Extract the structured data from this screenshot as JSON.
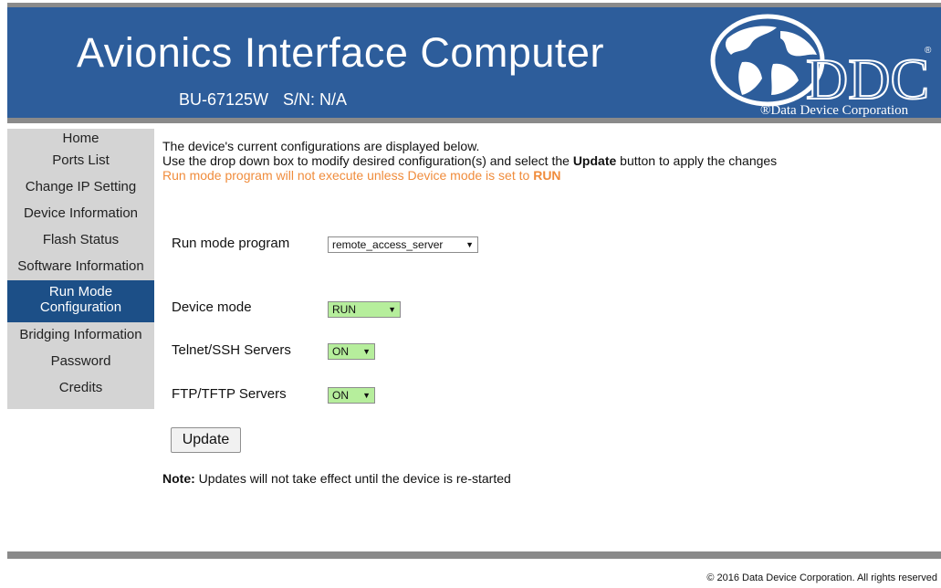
{
  "header": {
    "title": "Avionics Interface Computer",
    "model": "BU-67125W",
    "serial": "S/N: N/A",
    "logo_text": "DDC",
    "logo_caption": "®Data Device Corporation",
    "logo_mark": "®"
  },
  "sidebar": {
    "items": [
      {
        "label": "Home"
      },
      {
        "label": "Ports List"
      },
      {
        "label": "Change IP Setting"
      },
      {
        "label": "Device Information"
      },
      {
        "label": "Flash Status"
      },
      {
        "label": "Software Information"
      },
      {
        "label": "Run Mode Configuration"
      },
      {
        "label": "Bridging Information"
      },
      {
        "label": "Password"
      },
      {
        "label": "Credits"
      }
    ],
    "active_index": 6
  },
  "main": {
    "intro_line1": "The device's current configurations are displayed below.",
    "intro_line2_prefix": "Use the drop down box to modify desired configuration(s) and select the ",
    "intro_line2_bold": "Update",
    "intro_line2_suffix": " button to apply the changes",
    "warning_prefix": "Run mode program will not execute unless Device mode is set to ",
    "warning_bold": "RUN",
    "fields": {
      "run_mode_program": {
        "label": "Run mode program",
        "value": "remote_access_server"
      },
      "device_mode": {
        "label": "Device mode",
        "value": "RUN"
      },
      "telnet_ssh": {
        "label": "Telnet/SSH Servers",
        "value": "ON"
      },
      "ftp_tftp": {
        "label": "FTP/TFTP Servers",
        "value": "ON"
      }
    },
    "update_label": "Update",
    "note_bold": "Note:",
    "note_text": " Updates will not take effect until the device is re-started"
  },
  "footer": {
    "copyright": "© 2016 Data Device Corporation. All rights reserved"
  },
  "colors": {
    "header_bg": "#2d5d9b",
    "active_nav": "#1c4f87",
    "sidebar_bg": "#d4d4d4",
    "warning": "#f08c3c",
    "select_green": "#b6ee9c"
  }
}
